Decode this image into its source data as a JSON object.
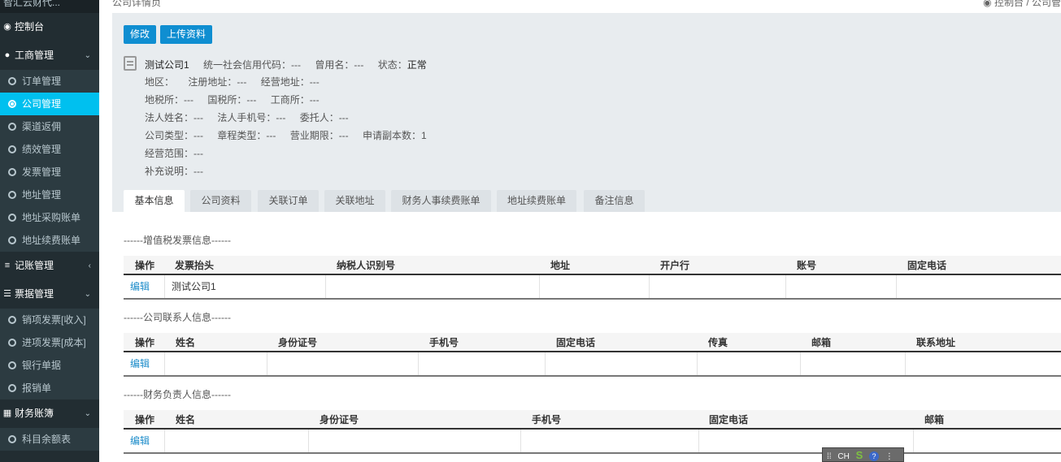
{
  "sidebar": {
    "top": "智汇云财代...",
    "dashboard": "控制台",
    "groups": {
      "business": "工商管理",
      "bookkeeping": "记账管理",
      "bills": "票据管理",
      "finance": "财务账簿"
    },
    "business_items": [
      "订单管理",
      "公司管理",
      "渠道返佣",
      "绩效管理",
      "发票管理",
      "地址管理",
      "地址采购账单",
      "地址续费账单"
    ],
    "bills_items": [
      "销项发票[收入]",
      "进项发票[成本]",
      "银行单据",
      "报销单"
    ],
    "finance_items": [
      "科目余额表"
    ]
  },
  "header": {
    "title": "公司详情页",
    "breadcrumb": "控制台 / 公司管"
  },
  "buttons": {
    "edit": "修改",
    "upload": "上传资料"
  },
  "company": {
    "name": "测试公司1",
    "credit_code": "统一社会信用代码：---",
    "former_name": "曾用名：---",
    "status_label": "状态：",
    "status_value": "正常",
    "region": "地区：",
    "reg_address": "注册地址：---",
    "biz_address": "经营地址：---",
    "local_tax": "地税所：---",
    "national_tax": "国税所：---",
    "industry_office": "工商所：---",
    "legal_name": "法人姓名：---",
    "legal_phone": "法人手机号：---",
    "trustee": "委托人：---",
    "company_type": "公司类型：---",
    "charter_type": "章程类型：---",
    "biz_term": "营业期限：---",
    "copies": "申请副本数：1",
    "scope": "经营范围：---",
    "remarks": "补充说明：---"
  },
  "tabs": [
    "基本信息",
    "公司资料",
    "关联订单",
    "关联地址",
    "财务人事续费账单",
    "地址续费账单",
    "备注信息"
  ],
  "invoice": {
    "title": "------增值税发票信息------",
    "headers": [
      "操作",
      "发票抬头",
      "纳税人识别号",
      "地址",
      "开户行",
      "账号",
      "固定电话"
    ],
    "row": [
      "编辑",
      "测试公司1",
      "",
      "",
      "",
      "",
      ""
    ]
  },
  "contact": {
    "title": "------公司联系人信息------",
    "headers": [
      "操作",
      "姓名",
      "身份证号",
      "手机号",
      "固定电话",
      "传真",
      "邮箱",
      "联系地址"
    ],
    "row": [
      "编辑",
      "",
      "",
      "",
      "",
      "",
      "",
      ""
    ]
  },
  "finance_contact": {
    "title": "------财务负责人信息------",
    "headers": [
      "操作",
      "姓名",
      "身份证号",
      "手机号",
      "固定电话",
      "邮箱"
    ],
    "row": [
      "编辑",
      "",
      "",
      "",
      "",
      ""
    ]
  },
  "ime": {
    "lang": "CH",
    "logo": "S",
    "help": "?"
  }
}
